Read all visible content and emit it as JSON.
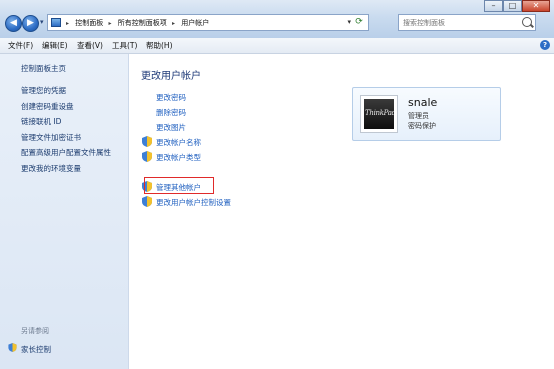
{
  "address_bar": {
    "crumbs": [
      "控制面板",
      "所有控制面板项",
      "用户帐户"
    ]
  },
  "search": {
    "placeholder": "搜索控制面板"
  },
  "window": {
    "minimize": "–",
    "maximize": "□",
    "close": "✕"
  },
  "menu": {
    "file": "文件(F)",
    "edit": "编辑(E)",
    "view": "查看(V)",
    "tools": "工具(T)",
    "help": "帮助(H)",
    "help_icon": "?"
  },
  "sidebar": {
    "home": "控制面板主页",
    "items": [
      "管理您的凭据",
      "创建密码重设盘",
      "链接联机 ID",
      "管理文件加密证书",
      "配置高级用户配置文件属性",
      "更改我的环境变量"
    ],
    "see_also_title": "另请参阅",
    "see_also_items": [
      "家长控制"
    ]
  },
  "main": {
    "title": "更改用户帐户",
    "tasks": [
      "更改密码",
      "删除密码",
      "更改图片",
      "更改帐户名称",
      "更改帐户类型"
    ],
    "other_tasks": [
      "管理其他帐户",
      "更改用户帐户控制设置"
    ]
  },
  "account": {
    "name": "snale",
    "role": "管理员",
    "status": "密码保护",
    "picture_text": "ThinkPad"
  },
  "colors": {
    "link": "#2060c0",
    "title": "#1e3a78",
    "highlight_border": "#e02a2a"
  }
}
